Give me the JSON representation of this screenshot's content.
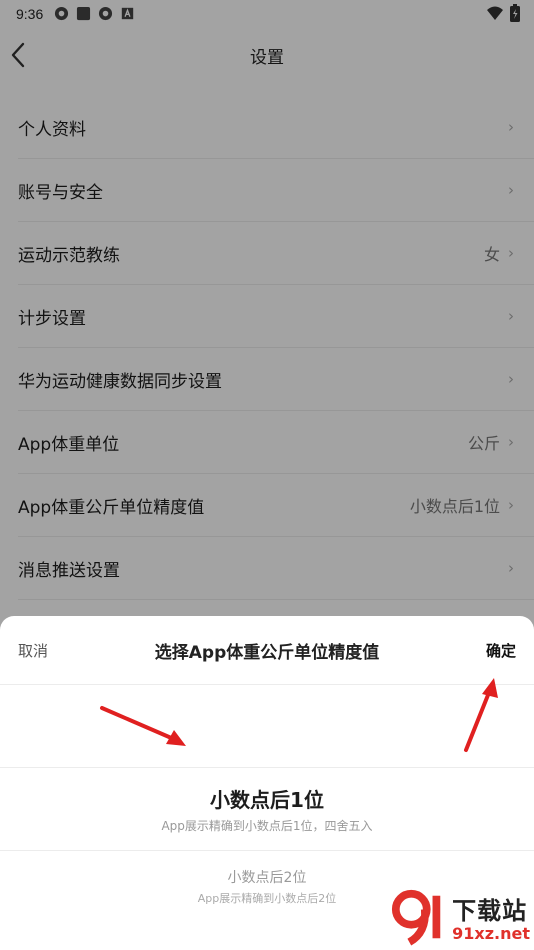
{
  "status_bar": {
    "time": "9:36"
  },
  "header": {
    "title": "设置"
  },
  "settings": [
    {
      "label": "个人资料",
      "value": ""
    },
    {
      "label": "账号与安全",
      "value": ""
    },
    {
      "label": "运动示范教练",
      "value": "女"
    },
    {
      "label": "计步设置",
      "value": ""
    },
    {
      "label": "华为运动健康数据同步设置",
      "value": ""
    },
    {
      "label": "App体重单位",
      "value": "公斤"
    },
    {
      "label": "App体重公斤单位精度值",
      "value": "小数点后1位"
    },
    {
      "label": "消息推送设置",
      "value": ""
    }
  ],
  "picker": {
    "cancel": "取消",
    "title": "选择App体重公斤单位精度值",
    "confirm": "确定",
    "options": [
      {
        "title": "小数点后1位",
        "desc": "App展示精确到小数点后1位，四舍五入",
        "selected": true
      },
      {
        "title": "小数点后2位",
        "desc": "App展示精确到小数点后2位",
        "selected": false
      }
    ]
  },
  "watermark": {
    "name": "下载站",
    "url": "91xz.net"
  },
  "colors": {
    "annotation_arrow": "#e02020",
    "watermark_red": "#e0312b"
  }
}
